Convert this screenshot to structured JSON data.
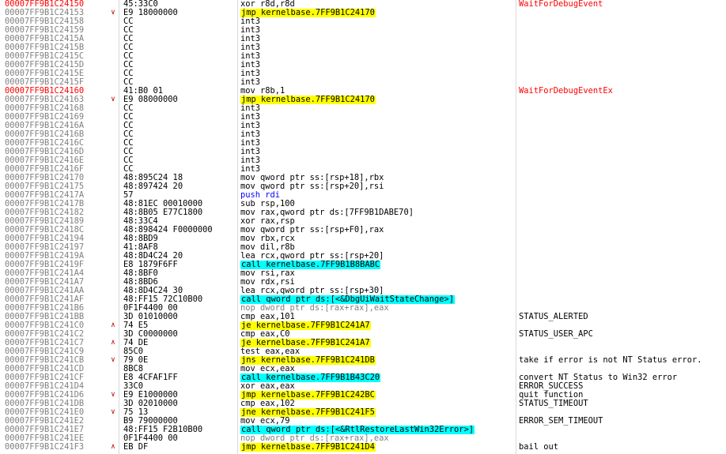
{
  "disassembly": {
    "rows": [
      {
        "addr": "00007FF9B1C24150",
        "addr_label": true,
        "arrow": "",
        "bytes": "45:33C0",
        "instr": "xor r8d,r8d",
        "kind": "normal",
        "comment": "WaitForDebugEvent",
        "comment_label": true
      },
      {
        "addr": "00007FF9B1C24153",
        "addr_label": false,
        "arrow": "∨",
        "bytes": "E9 18000000",
        "instr": "jmp kernelbase.7FF9B1C24170",
        "kind": "jmp",
        "comment": "",
        "comment_label": false
      },
      {
        "addr": "00007FF9B1C24158",
        "addr_label": false,
        "arrow": "",
        "bytes": "CC",
        "instr": "int3",
        "kind": "normal",
        "comment": "",
        "comment_label": false
      },
      {
        "addr": "00007FF9B1C24159",
        "addr_label": false,
        "arrow": "",
        "bytes": "CC",
        "instr": "int3",
        "kind": "normal",
        "comment": "",
        "comment_label": false
      },
      {
        "addr": "00007FF9B1C2415A",
        "addr_label": false,
        "arrow": "",
        "bytes": "CC",
        "instr": "int3",
        "kind": "normal",
        "comment": "",
        "comment_label": false
      },
      {
        "addr": "00007FF9B1C2415B",
        "addr_label": false,
        "arrow": "",
        "bytes": "CC",
        "instr": "int3",
        "kind": "normal",
        "comment": "",
        "comment_label": false
      },
      {
        "addr": "00007FF9B1C2415C",
        "addr_label": false,
        "arrow": "",
        "bytes": "CC",
        "instr": "int3",
        "kind": "normal",
        "comment": "",
        "comment_label": false
      },
      {
        "addr": "00007FF9B1C2415D",
        "addr_label": false,
        "arrow": "",
        "bytes": "CC",
        "instr": "int3",
        "kind": "normal",
        "comment": "",
        "comment_label": false
      },
      {
        "addr": "00007FF9B1C2415E",
        "addr_label": false,
        "arrow": "",
        "bytes": "CC",
        "instr": "int3",
        "kind": "normal",
        "comment": "",
        "comment_label": false
      },
      {
        "addr": "00007FF9B1C2415F",
        "addr_label": false,
        "arrow": "",
        "bytes": "CC",
        "instr": "int3",
        "kind": "normal",
        "comment": "",
        "comment_label": false
      },
      {
        "addr": "00007FF9B1C24160",
        "addr_label": true,
        "arrow": "",
        "bytes": "41:B0 01",
        "instr": "mov r8b,1",
        "kind": "normal",
        "comment": "WaitForDebugEventEx",
        "comment_label": true
      },
      {
        "addr": "00007FF9B1C24163",
        "addr_label": false,
        "arrow": "∨",
        "bytes": "E9 08000000",
        "instr": "jmp kernelbase.7FF9B1C24170",
        "kind": "jmp",
        "comment": "",
        "comment_label": false
      },
      {
        "addr": "00007FF9B1C24168",
        "addr_label": false,
        "arrow": "",
        "bytes": "CC",
        "instr": "int3",
        "kind": "normal",
        "comment": "",
        "comment_label": false
      },
      {
        "addr": "00007FF9B1C24169",
        "addr_label": false,
        "arrow": "",
        "bytes": "CC",
        "instr": "int3",
        "kind": "normal",
        "comment": "",
        "comment_label": false
      },
      {
        "addr": "00007FF9B1C2416A",
        "addr_label": false,
        "arrow": "",
        "bytes": "CC",
        "instr": "int3",
        "kind": "normal",
        "comment": "",
        "comment_label": false
      },
      {
        "addr": "00007FF9B1C2416B",
        "addr_label": false,
        "arrow": "",
        "bytes": "CC",
        "instr": "int3",
        "kind": "normal",
        "comment": "",
        "comment_label": false
      },
      {
        "addr": "00007FF9B1C2416C",
        "addr_label": false,
        "arrow": "",
        "bytes": "CC",
        "instr": "int3",
        "kind": "normal",
        "comment": "",
        "comment_label": false
      },
      {
        "addr": "00007FF9B1C2416D",
        "addr_label": false,
        "arrow": "",
        "bytes": "CC",
        "instr": "int3",
        "kind": "normal",
        "comment": "",
        "comment_label": false
      },
      {
        "addr": "00007FF9B1C2416E",
        "addr_label": false,
        "arrow": "",
        "bytes": "CC",
        "instr": "int3",
        "kind": "normal",
        "comment": "",
        "comment_label": false
      },
      {
        "addr": "00007FF9B1C2416F",
        "addr_label": false,
        "arrow": "",
        "bytes": "CC",
        "instr": "int3",
        "kind": "normal",
        "comment": "",
        "comment_label": false
      },
      {
        "addr": "00007FF9B1C24170",
        "addr_label": false,
        "arrow": "",
        "bytes": "48:895C24 18",
        "instr": "mov qword ptr ss:[rsp+18],rbx",
        "kind": "normal",
        "comment": "",
        "comment_label": false
      },
      {
        "addr": "00007FF9B1C24175",
        "addr_label": false,
        "arrow": "",
        "bytes": "48:897424 20",
        "instr": "mov qword ptr ss:[rsp+20],rsi",
        "kind": "normal",
        "comment": "",
        "comment_label": false
      },
      {
        "addr": "00007FF9B1C2417A",
        "addr_label": false,
        "arrow": "",
        "bytes": "57",
        "instr": "push rdi",
        "kind": "push",
        "comment": "",
        "comment_label": false
      },
      {
        "addr": "00007FF9B1C2417B",
        "addr_label": false,
        "arrow": "",
        "bytes": "48:81EC 00010000",
        "instr": "sub rsp,100",
        "kind": "normal",
        "comment": "",
        "comment_label": false
      },
      {
        "addr": "00007FF9B1C24182",
        "addr_label": false,
        "arrow": "",
        "bytes": "48:8B05 E77C1800",
        "instr": "mov rax,qword ptr ds:[7FF9B1DABE70]",
        "kind": "normal",
        "comment": "",
        "comment_label": false
      },
      {
        "addr": "00007FF9B1C24189",
        "addr_label": false,
        "arrow": "",
        "bytes": "48:33C4",
        "instr": "xor rax,rsp",
        "kind": "normal",
        "comment": "",
        "comment_label": false
      },
      {
        "addr": "00007FF9B1C2418C",
        "addr_label": false,
        "arrow": "",
        "bytes": "48:898424 F0000000",
        "instr": "mov qword ptr ss:[rsp+F0],rax",
        "kind": "normal",
        "comment": "",
        "comment_label": false
      },
      {
        "addr": "00007FF9B1C24194",
        "addr_label": false,
        "arrow": "",
        "bytes": "48:8BD9",
        "instr": "mov rbx,rcx",
        "kind": "normal",
        "comment": "",
        "comment_label": false
      },
      {
        "addr": "00007FF9B1C24197",
        "addr_label": false,
        "arrow": "",
        "bytes": "41:8AF8",
        "instr": "mov dil,r8b",
        "kind": "normal",
        "comment": "",
        "comment_label": false
      },
      {
        "addr": "00007FF9B1C2419A",
        "addr_label": false,
        "arrow": "",
        "bytes": "48:8D4C24 20",
        "instr": "lea rcx,qword ptr ss:[rsp+20]",
        "kind": "normal",
        "comment": "",
        "comment_label": false
      },
      {
        "addr": "00007FF9B1C2419F",
        "addr_label": false,
        "arrow": "",
        "bytes": "E8 1879F6FF",
        "instr": "call kernelbase.7FF9B1B8BABC",
        "kind": "call",
        "comment": "",
        "comment_label": false
      },
      {
        "addr": "00007FF9B1C241A4",
        "addr_label": false,
        "arrow": "",
        "bytes": "48:8BF0",
        "instr": "mov rsi,rax",
        "kind": "normal",
        "comment": "",
        "comment_label": false
      },
      {
        "addr": "00007FF9B1C241A7",
        "addr_label": false,
        "arrow": "",
        "bytes": "48:8BD6",
        "instr": "mov rdx,rsi",
        "kind": "normal",
        "comment": "",
        "comment_label": false
      },
      {
        "addr": "00007FF9B1C241AA",
        "addr_label": false,
        "arrow": "",
        "bytes": "48:8D4C24 30",
        "instr": "lea rcx,qword ptr ss:[rsp+30]",
        "kind": "normal",
        "comment": "",
        "comment_label": false
      },
      {
        "addr": "00007FF9B1C241AF",
        "addr_label": false,
        "arrow": "",
        "bytes": "48:FF15 72C10B00",
        "instr": "call qword ptr ds:[<&DbgUiWaitStateChange>]",
        "kind": "call",
        "comment": "",
        "comment_label": false
      },
      {
        "addr": "00007FF9B1C241B6",
        "addr_label": false,
        "arrow": "",
        "bytes": "0F1F4400 00",
        "instr": "nop dword ptr ds:[rax+rax],eax",
        "kind": "nop",
        "comment": "",
        "comment_label": false
      },
      {
        "addr": "00007FF9B1C241BB",
        "addr_label": false,
        "arrow": "",
        "bytes": "3D 01010000",
        "instr": "cmp eax,101",
        "kind": "normal",
        "comment": "STATUS_ALERTED",
        "comment_label": false
      },
      {
        "addr": "00007FF9B1C241C0",
        "addr_label": false,
        "arrow": "∧",
        "bytes": "74 E5",
        "instr": "je kernelbase.7FF9B1C241A7",
        "kind": "jmp",
        "comment": "",
        "comment_label": false
      },
      {
        "addr": "00007FF9B1C241C2",
        "addr_label": false,
        "arrow": "",
        "bytes": "3D C0000000",
        "instr": "cmp eax,C0",
        "kind": "normal",
        "comment": "STATUS_USER_APC",
        "comment_label": false
      },
      {
        "addr": "00007FF9B1C241C7",
        "addr_label": false,
        "arrow": "∧",
        "bytes": "74 DE",
        "instr": "je kernelbase.7FF9B1C241A7",
        "kind": "jmp",
        "comment": "",
        "comment_label": false
      },
      {
        "addr": "00007FF9B1C241C9",
        "addr_label": false,
        "arrow": "",
        "bytes": "85C0",
        "instr": "test eax,eax",
        "kind": "normal",
        "comment": "",
        "comment_label": false
      },
      {
        "addr": "00007FF9B1C241CB",
        "addr_label": false,
        "arrow": "∨",
        "bytes": "79 0E",
        "instr": "jns kernelbase.7FF9B1C241DB",
        "kind": "jmp",
        "comment": "take if error is not NT Status error.",
        "comment_label": false
      },
      {
        "addr": "00007FF9B1C241CD",
        "addr_label": false,
        "arrow": "",
        "bytes": "8BC8",
        "instr": "mov ecx,eax",
        "kind": "normal",
        "comment": "",
        "comment_label": false
      },
      {
        "addr": "00007FF9B1C241CF",
        "addr_label": false,
        "arrow": "",
        "bytes": "E8 4CFAF1FF",
        "instr": "call kernelbase.7FF9B1B43C20",
        "kind": "call",
        "comment": "convert NT Status to Win32 error",
        "comment_label": false
      },
      {
        "addr": "00007FF9B1C241D4",
        "addr_label": false,
        "arrow": "",
        "bytes": "33C0",
        "instr": "xor eax,eax",
        "kind": "normal",
        "comment": "ERROR_SUCCESS",
        "comment_label": false
      },
      {
        "addr": "00007FF9B1C241D6",
        "addr_label": false,
        "arrow": "∨",
        "bytes": "E9 E1000000",
        "instr": "jmp kernelbase.7FF9B1C242BC",
        "kind": "jmp",
        "comment": "quit function",
        "comment_label": false
      },
      {
        "addr": "00007FF9B1C241DB",
        "addr_label": false,
        "arrow": "",
        "bytes": "3D 02010000",
        "instr": "cmp eax,102",
        "kind": "normal",
        "comment": "STATUS_TIMEOUT",
        "comment_label": false
      },
      {
        "addr": "00007FF9B1C241E0",
        "addr_label": false,
        "arrow": "∨",
        "bytes": "75 13",
        "instr": "jne kernelbase.7FF9B1C241F5",
        "kind": "jmp",
        "comment": "",
        "comment_label": false
      },
      {
        "addr": "00007FF9B1C241E2",
        "addr_label": false,
        "arrow": "",
        "bytes": "B9 79000000",
        "instr": "mov ecx,79",
        "kind": "normal",
        "comment": "ERROR_SEM_TIMEOUT",
        "comment_label": false
      },
      {
        "addr": "00007FF9B1C241E7",
        "addr_label": false,
        "arrow": "",
        "bytes": "48:FF15 F2B10B00",
        "instr": "call qword ptr ds:[<&RtlRestoreLastWin32Error>]",
        "kind": "call",
        "comment": "",
        "comment_label": false
      },
      {
        "addr": "00007FF9B1C241EE",
        "addr_label": false,
        "arrow": "",
        "bytes": "0F1F4400 00",
        "instr": "nop dword ptr ds:[rax+rax],eax",
        "kind": "nop",
        "comment": "",
        "comment_label": false
      },
      {
        "addr": "00007FF9B1C241F3",
        "addr_label": false,
        "arrow": "∧",
        "bytes": "EB DF",
        "instr": "jmp kernelbase.7FF9B1C241D4",
        "kind": "jmp",
        "comment": "bail out",
        "comment_label": false
      }
    ]
  }
}
